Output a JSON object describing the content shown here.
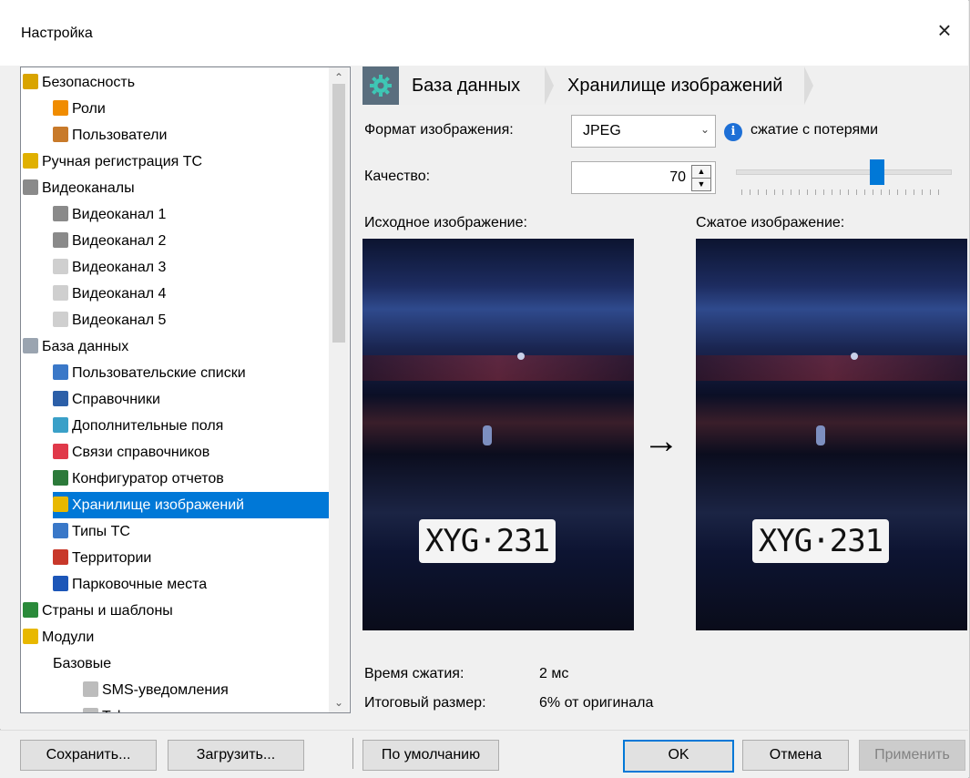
{
  "window": {
    "title": "Настройка",
    "close_icon": "×"
  },
  "tree": {
    "items": [
      {
        "label": "Безопасность",
        "indent": 0,
        "icon": "lock-icon",
        "color": "#d9a400"
      },
      {
        "label": "Роли",
        "indent": 1,
        "icon": "roles-icon",
        "color": "#f08c00"
      },
      {
        "label": "Пользователи",
        "indent": 1,
        "icon": "users-icon",
        "color": "#c87a2a"
      },
      {
        "label": "Ручная регистрация ТС",
        "indent": 0,
        "icon": "pencil-icon",
        "color": "#e0b000"
      },
      {
        "label": "Видеоканалы",
        "indent": 0,
        "icon": "camera-icon",
        "color": "#8a8a8a"
      },
      {
        "label": "Видеоканал 1",
        "indent": 1,
        "icon": "camera-icon",
        "color": "#8a8a8a"
      },
      {
        "label": "Видеоканал 2",
        "indent": 1,
        "icon": "camera-icon",
        "color": "#8a8a8a"
      },
      {
        "label": "Видеоканал 3",
        "indent": 1,
        "icon": "camera-disabled-icon",
        "color": "#cfcfcf"
      },
      {
        "label": "Видеоканал 4",
        "indent": 1,
        "icon": "camera-disabled-icon",
        "color": "#cfcfcf"
      },
      {
        "label": "Видеоканал 5",
        "indent": 1,
        "icon": "camera-disabled-icon",
        "color": "#cfcfcf"
      },
      {
        "label": "База данных",
        "indent": 0,
        "icon": "database-icon",
        "color": "#9aa4b0"
      },
      {
        "label": "Пользовательские списки",
        "indent": 1,
        "icon": "list-icon",
        "color": "#3a78c8"
      },
      {
        "label": "Справочники",
        "indent": 1,
        "icon": "books-icon",
        "color": "#2c5fa8"
      },
      {
        "label": "Дополнительные поля",
        "indent": 1,
        "icon": "fields-icon",
        "color": "#3aa0c8"
      },
      {
        "label": "Связи справочников",
        "indent": 1,
        "icon": "links-icon",
        "color": "#e0394a"
      },
      {
        "label": "Конфигуратор отчетов",
        "indent": 1,
        "icon": "report-icon",
        "color": "#2c7a3a"
      },
      {
        "label": "Хранилище изображений",
        "indent": 1,
        "icon": "image-storage-icon",
        "color": "#e8b800",
        "selected": true
      },
      {
        "label": "Типы ТС",
        "indent": 1,
        "icon": "car-icon",
        "color": "#3a78c8"
      },
      {
        "label": "Территории",
        "indent": 1,
        "icon": "territory-icon",
        "color": "#c8382a"
      },
      {
        "label": "Парковочные места",
        "indent": 1,
        "icon": "parking-icon",
        "color": "#1c56b8"
      },
      {
        "label": "Страны и шаблоны",
        "indent": 0,
        "icon": "globe-icon",
        "color": "#2a8a3a"
      },
      {
        "label": "Модули",
        "indent": 0,
        "icon": "puzzle-icon",
        "color": "#e8b800"
      },
      {
        "label": "Базовые",
        "indent": 1,
        "icon": "",
        "color": ""
      },
      {
        "label": "SMS-уведомления",
        "indent": 2,
        "icon": "puzzle-gray-icon",
        "color": "#bcbcbc"
      },
      {
        "label": "Telegram-уведомления",
        "indent": 2,
        "icon": "puzzle-gray-icon",
        "color": "#bcbcbc"
      }
    ]
  },
  "breadcrumb": {
    "gear_icon": "gear-icon",
    "items": [
      "База данных",
      "Хранилище изображений"
    ]
  },
  "format": {
    "label": "Формат изображения:",
    "value": "JPEG",
    "info_text": "сжатие с потерями"
  },
  "quality": {
    "label": "Качество:",
    "value": "70",
    "slider_value": 70,
    "slider_max": 100
  },
  "images": {
    "original_label": "Исходное изображение:",
    "compressed_label": "Сжатое изображение:",
    "plate_text": "XYG·231"
  },
  "stats": {
    "time_label": "Время сжатия:",
    "time_value": "2 мс",
    "size_label": "Итоговый размер:",
    "size_value": "6% от оригинала"
  },
  "buttons": {
    "save": "Сохранить...",
    "load": "Загрузить...",
    "defaults": "По умолчанию",
    "ok": "OK",
    "cancel": "Отмена",
    "apply": "Применить"
  }
}
